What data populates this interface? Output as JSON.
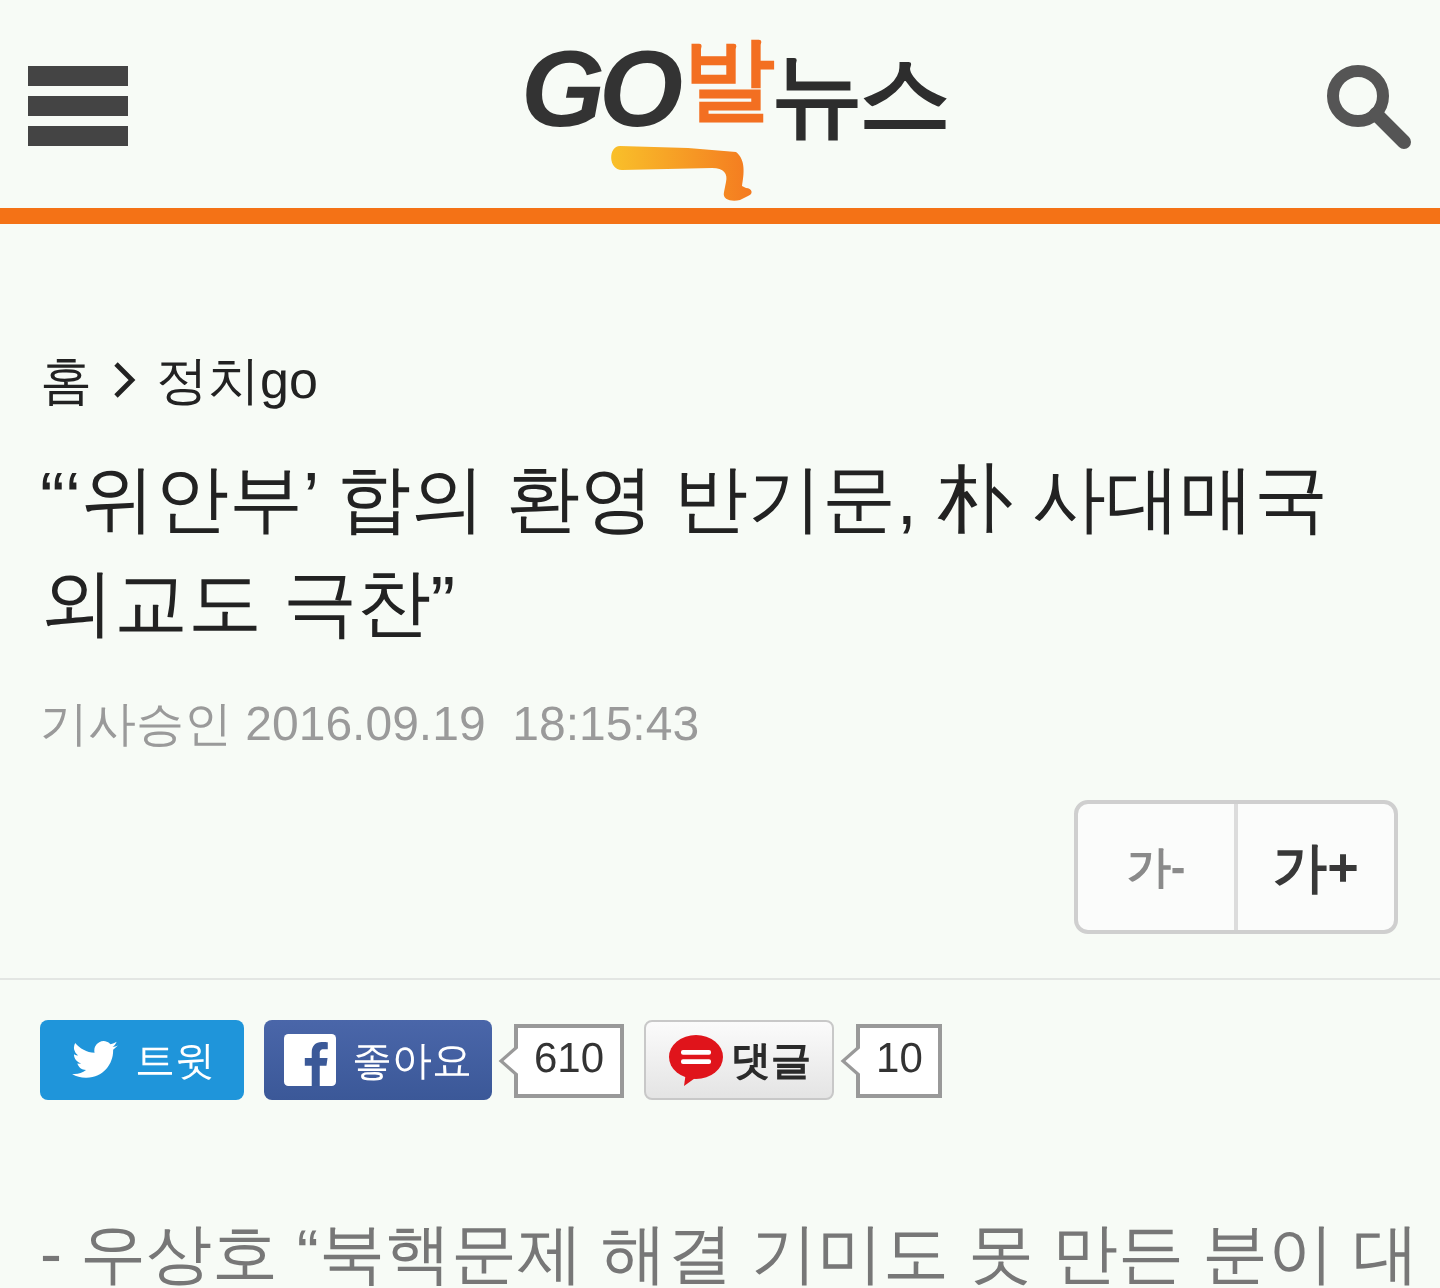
{
  "header": {
    "logo": [
      {
        "text": "GO",
        "kind": "latin"
      },
      {
        "text": "발",
        "kind": "accent"
      },
      {
        "text": "뉴스",
        "kind": "plain"
      }
    ]
  },
  "breadcrumb": [
    {
      "label": "홈"
    },
    {
      "label": "정치go"
    }
  ],
  "article": {
    "title": "“‘위안부’ 합의 환영 반기문, 朴 사대매국 외교도 극찬”",
    "published": "기사승인 2016.09.19  18:15:43"
  },
  "font_size_buttons": [
    {
      "label": "가-",
      "kind": "decrease"
    },
    {
      "label": "가+",
      "kind": "increase"
    }
  ],
  "share": [
    {
      "kind": "twitter",
      "label": "트윗"
    },
    {
      "kind": "facebook",
      "label": "좋아요",
      "count": "610"
    },
    {
      "kind": "comment",
      "label": "댓글",
      "count": "10"
    }
  ],
  "subtitle": "- 우상호 “북핵문제 해결 기미도 못 만든 분이 대"
}
